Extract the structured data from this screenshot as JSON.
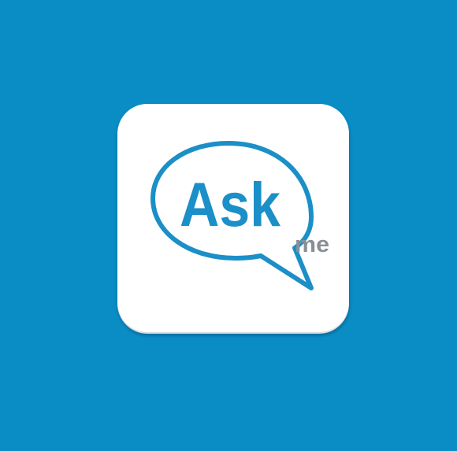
{
  "logo": {
    "primary_text": "Ask",
    "secondary_text": "me",
    "icon": "speech-bubble-icon"
  },
  "colors": {
    "background": "#0a8cc5",
    "tile": "#ffffff",
    "accent": "#1b8fc7",
    "secondary_text": "#8a8f94"
  }
}
